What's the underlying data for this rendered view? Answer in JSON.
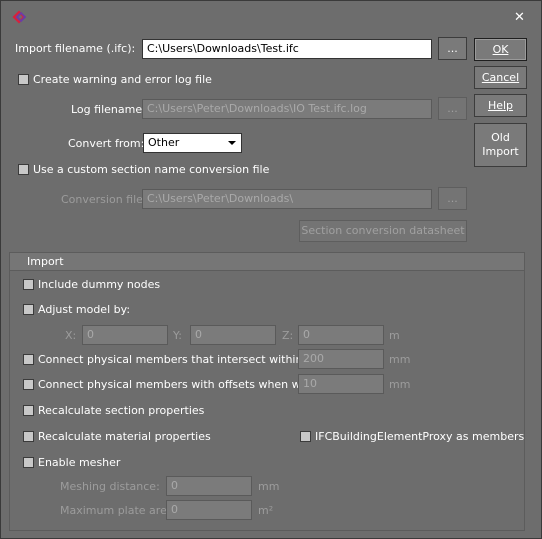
{
  "window": {
    "close_glyph": "✕"
  },
  "main": {
    "import_filename_label": "Import filename (.ifc):",
    "import_filename_value": "C:\\Users\\Downloads\\Test.ifc",
    "browse_label": "...",
    "create_log_label": "Create warning and error log file",
    "create_log_checked": false,
    "log_filename_label": "Log filename:",
    "log_filename_value": "C:\\Users\\Peter\\Downloads\\IO Test.ifc.log",
    "convert_from_label": "Convert from:",
    "convert_from_value": "Other",
    "custom_section_label": "Use a custom section name conversion file",
    "custom_section_checked": false,
    "conversion_file_label": "Conversion file:",
    "conversion_file_value": "C:\\Users\\Peter\\Downloads\\",
    "section_datasheet_label": "Section conversion datasheet"
  },
  "buttons": {
    "ok": "OK",
    "cancel": "Cancel",
    "help": "Help",
    "old_import_line1": "Old",
    "old_import_line2": "Import"
  },
  "import_group": {
    "title": "Import",
    "include_dummy_label": "Include dummy nodes",
    "adjust_model_label": "Adjust model by:",
    "x_label": "X:",
    "y_label": "Y:",
    "z_label": "Z:",
    "x_value": "0",
    "y_value": "0",
    "z_value": "0",
    "xyz_unit": "m",
    "connect_intersect_label": "Connect physical members that intersect within",
    "connect_intersect_value": "200",
    "connect_intersect_unit": "mm",
    "connect_offsets_label": "Connect physical members with offsets when within",
    "connect_offsets_value": "10",
    "connect_offsets_unit": "mm",
    "recalc_section_label": "Recalculate section properties",
    "recalc_material_label": "Recalculate material properties",
    "ifc_proxy_label": "IFCBuildingElementProxy as members",
    "enable_mesher_label": "Enable mesher",
    "meshing_distance_label": "Meshing distance:",
    "meshing_distance_value": "0",
    "meshing_distance_unit": "mm",
    "max_plate_area_label": "Maximum plate area:",
    "max_plate_area_value": "0",
    "max_plate_area_unit": "m²"
  },
  "colors": {
    "background": "#6d6d6d",
    "logo_red": "#d8203c",
    "logo_purple": "#6a3ca8"
  }
}
